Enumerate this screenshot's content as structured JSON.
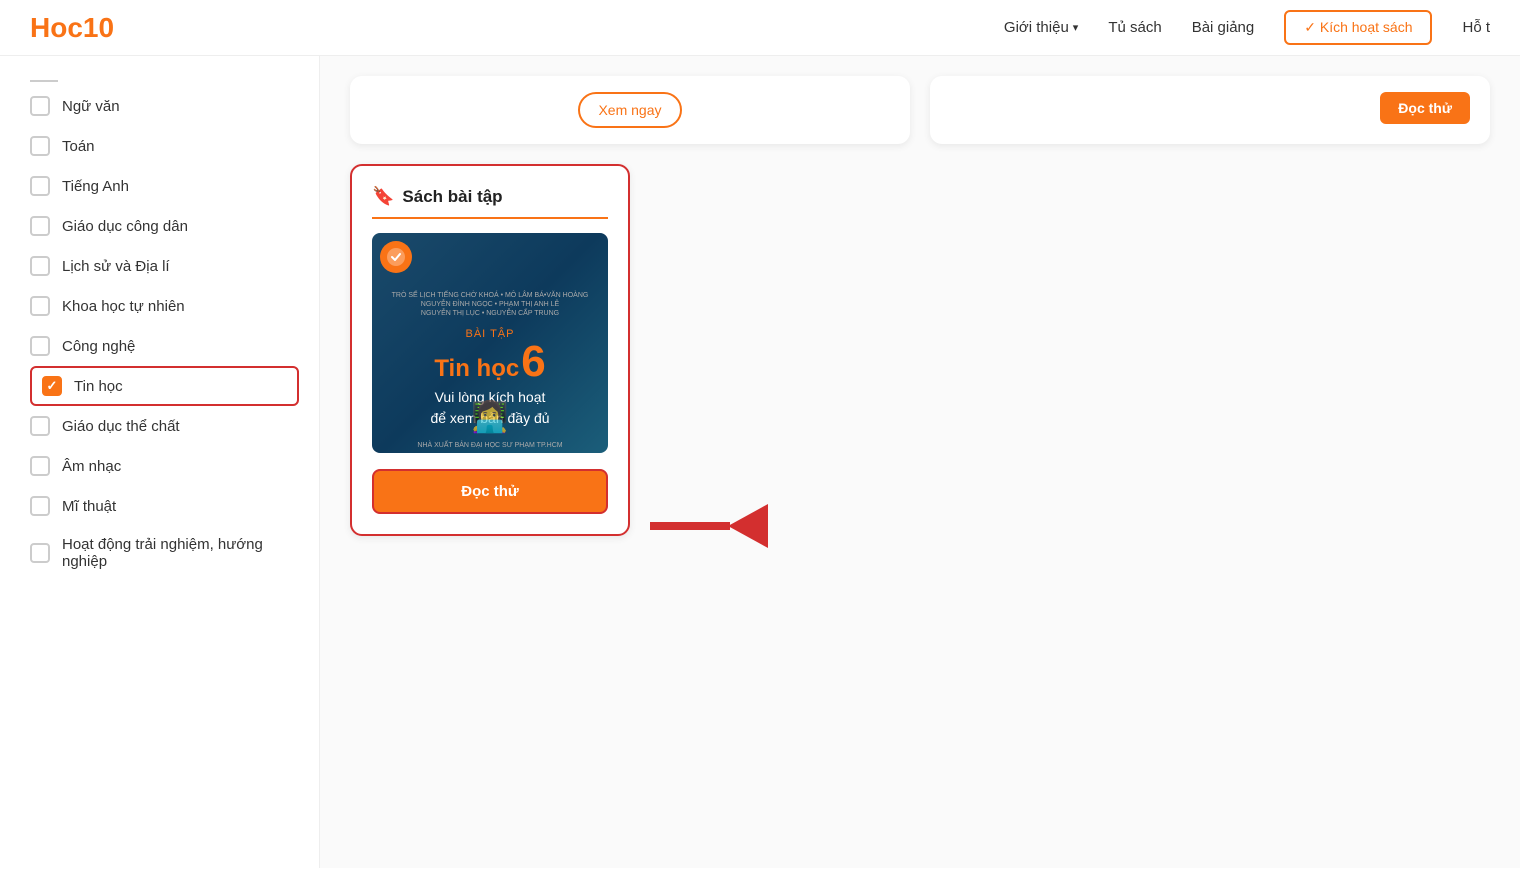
{
  "header": {
    "logo_text": "Hoc",
    "logo_number": "10",
    "nav_items": [
      {
        "label": "Giới thiệu",
        "has_dropdown": true
      },
      {
        "label": "Tủ sách",
        "has_dropdown": false
      },
      {
        "label": "Bài giảng",
        "has_dropdown": false
      }
    ],
    "activate_btn": "✓ Kích hoạt sách",
    "profile_label": "Hỗ t"
  },
  "sidebar": {
    "divider": true,
    "items": [
      {
        "id": "ngu-van",
        "label": "Ngữ văn",
        "checked": false
      },
      {
        "id": "toan",
        "label": "Toán",
        "checked": false
      },
      {
        "id": "tieng-anh",
        "label": "Tiếng Anh",
        "checked": false
      },
      {
        "id": "giao-duc-cong-dan",
        "label": "Giáo dục công dân",
        "checked": false
      },
      {
        "id": "lich-su-dia-li",
        "label": "Lịch sử và Địa lí",
        "checked": false
      },
      {
        "id": "khoa-hoc-tu-nhien",
        "label": "Khoa học tự nhiên",
        "checked": false
      },
      {
        "id": "cong-nghe",
        "label": "Công nghệ",
        "checked": false
      },
      {
        "id": "tin-hoc",
        "label": "Tin học",
        "checked": true,
        "highlighted": true
      },
      {
        "id": "giao-duc-the-chat",
        "label": "Giáo dục thể chất",
        "checked": false
      },
      {
        "id": "am-nhac",
        "label": "Âm nhạc",
        "checked": false
      },
      {
        "id": "mi-thuat",
        "label": "Mĩ thuật",
        "checked": false
      },
      {
        "id": "hoat-dong-trai-nghiem",
        "label": "Hoạt động trải nghiệm, hướng nghiệp",
        "checked": false
      }
    ]
  },
  "top_cards": {
    "card1_btn": "Xem ngay",
    "card2_btn": "Đọc thử"
  },
  "sach_bai_tap_card": {
    "title": "Sách bài tập",
    "book_text_top": "TRÒ TẾ LỊCH TIẾNG CHỜ KHOÁ • MÔ LÂM BÁ•VĂN HOÀNG\nNGUYỄN ĐÌNH NGỌC • PHẠM THỊ ANH LÊ\nNGUYỄN THỊ LỤC • NGUYỄN CẤP TRUNG",
    "book_subtitle": "BÀI TẬP",
    "book_title": "Tin học",
    "book_number": "6",
    "book_subtitle2": "Vui lòng kích hoạt\nđể xem bản đầy đủ",
    "book_footer": "NHÀ XUẤT BẢN ĐẠI HỌC SƯ PHẠM TP.HCM",
    "btn_doc_thu": "Đọc thử"
  },
  "arrow": {
    "visible": true
  }
}
